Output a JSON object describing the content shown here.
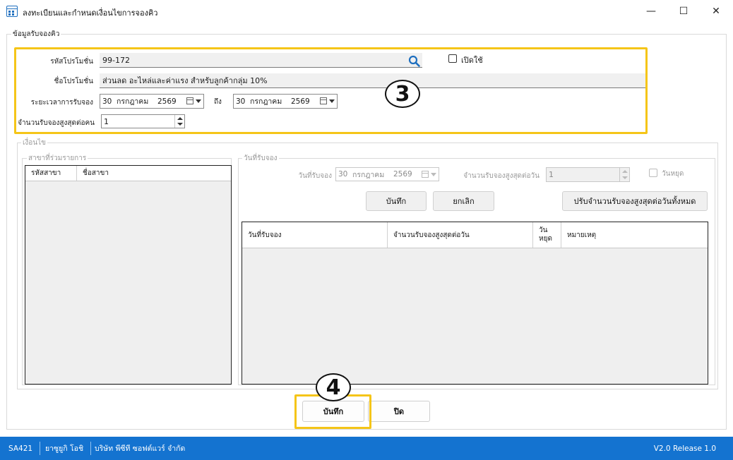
{
  "window": {
    "title": "ลงทะเบียนและกำหนดเงื่อนไขการจองคิว",
    "minimize": "—",
    "maximize": "☐",
    "close": "✕"
  },
  "booking_info": {
    "group_label": "ข้อมูลรับจองคิว",
    "promo_code_label": "รหัสโปรโมชั่น",
    "promo_code_value": "99-172",
    "open_label": "เปิดใช้",
    "promo_name_label": "ชื่อโปรโมชั่น",
    "promo_name_value": "ส่วนลด อะไหล่และค่าแรง สำหรับลูกค้ากลุ่ม 10%",
    "period_label": "ระยะเวลาการรับจอง",
    "period_from": {
      "day": "30",
      "month": "กรกฎาคม",
      "year": "2569"
    },
    "to_label": "ถึง",
    "period_to": {
      "day": "30",
      "month": "กรกฎาคม",
      "year": "2569"
    },
    "max_per_person_label": "จำนวนรับจองสูงสุดต่อคน",
    "max_per_person_value": "1"
  },
  "conditions": {
    "group_label": "เงื่อนไข",
    "branches": {
      "group_label": "สาขาที่ร่วมรายการ",
      "columns": [
        "รหัสสาขา",
        "ชื่อสาขา"
      ]
    },
    "booking_dates": {
      "group_label": "วันที่รับจอง",
      "date_label": "วันที่รับจอง",
      "date_value": {
        "day": "30",
        "month": "กรกฎาคม",
        "year": "2569"
      },
      "max_per_day_label": "จำนวนรับจองสูงสุดต่อวัน",
      "max_per_day_value": "1",
      "holiday_label": "วันหยุด",
      "save_label": "บันทึก",
      "cancel_label": "ยกเลิก",
      "adjust_all_label": "ปรับจำนวนรับจองสูงสุดต่อวันทั้งหมด",
      "columns": [
        "วันที่รับจอง",
        "จำนวนรับจองสูงสุดต่อวัน",
        "วัน\nหยุด",
        "หมายเหตุ"
      ]
    }
  },
  "footer": {
    "save_label": "บันทึก",
    "close_label": "ปิด"
  },
  "callouts": {
    "three": "3",
    "four": "4"
  },
  "statusbar": {
    "code": "SA421",
    "user": "ยาซูยูกิ โอชิ",
    "company": "บริษัท พีซีที ซอฟต์แวร์ จำกัด",
    "version": "V2.0 Release 1.0"
  },
  "colors": {
    "accent": "#1473d0",
    "highlight": "#f5c518",
    "search_icon": "#1e6fbf"
  },
  "icons": [
    "app-grid-icon",
    "search-icon",
    "calendar-icon",
    "dropdown-arrow-icon",
    "spin-up-icon",
    "spin-down-icon"
  ]
}
